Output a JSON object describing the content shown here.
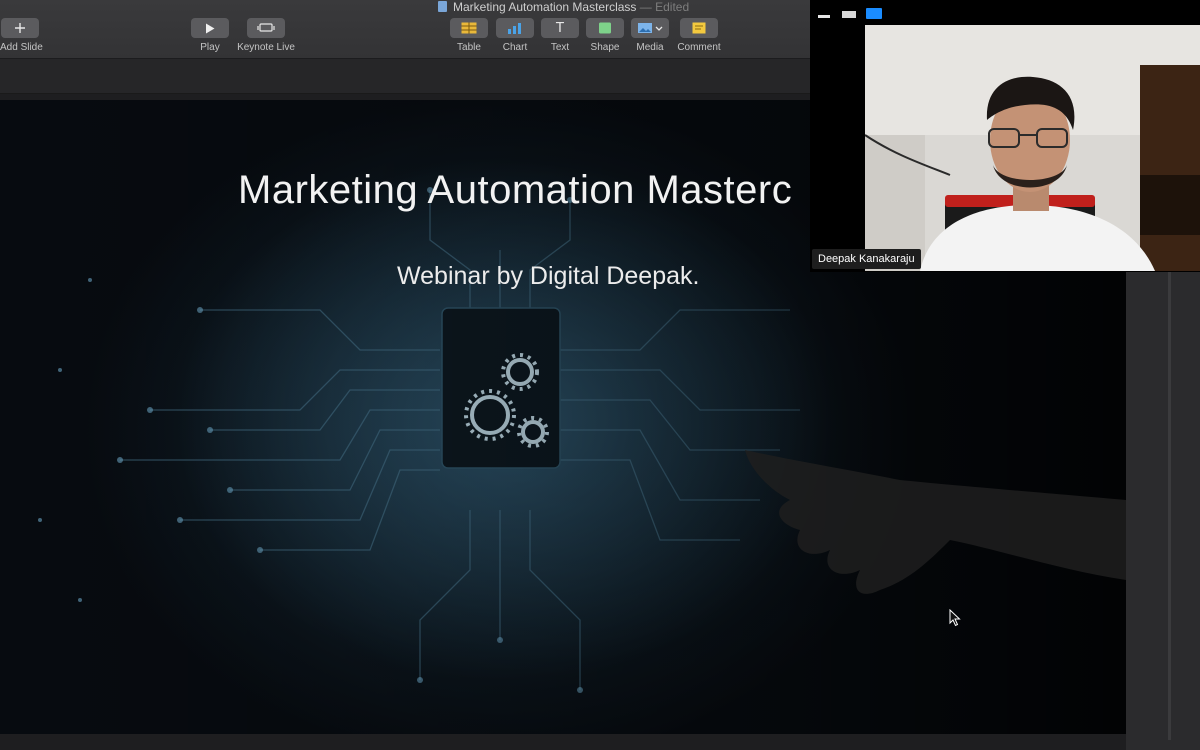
{
  "window": {
    "doc_title": "Marketing Automation Masterclass",
    "doc_status": "— Edited"
  },
  "toolbar": {
    "add_slide": {
      "label": "Add Slide",
      "icon": "plus-icon"
    },
    "play": {
      "label": "Play",
      "icon": "play-icon"
    },
    "keynote_live": {
      "label": "Keynote Live",
      "icon": "keynote-live-icon"
    },
    "table": {
      "label": "Table",
      "icon": "table-icon"
    },
    "chart": {
      "label": "Chart",
      "icon": "chart-icon"
    },
    "text": {
      "label": "Text",
      "icon": "text-icon",
      "glyph": "T"
    },
    "shape": {
      "label": "Shape",
      "icon": "shape-icon"
    },
    "media": {
      "label": "Media",
      "icon": "media-icon"
    },
    "comment": {
      "label": "Comment",
      "icon": "comment-icon"
    }
  },
  "slide": {
    "title": "Marketing Automation Masterc",
    "subtitle": "Webinar by Digital Deepak."
  },
  "video": {
    "participant_name": "Deepak Kanakaraju",
    "controls": [
      "minimize-icon",
      "restore-icon",
      "fullscreen-icon"
    ]
  },
  "colors": {
    "accent_blue": "#1a8cff",
    "slide_bg": "#070b10",
    "toolbar_bg": "#3a3a3c"
  }
}
